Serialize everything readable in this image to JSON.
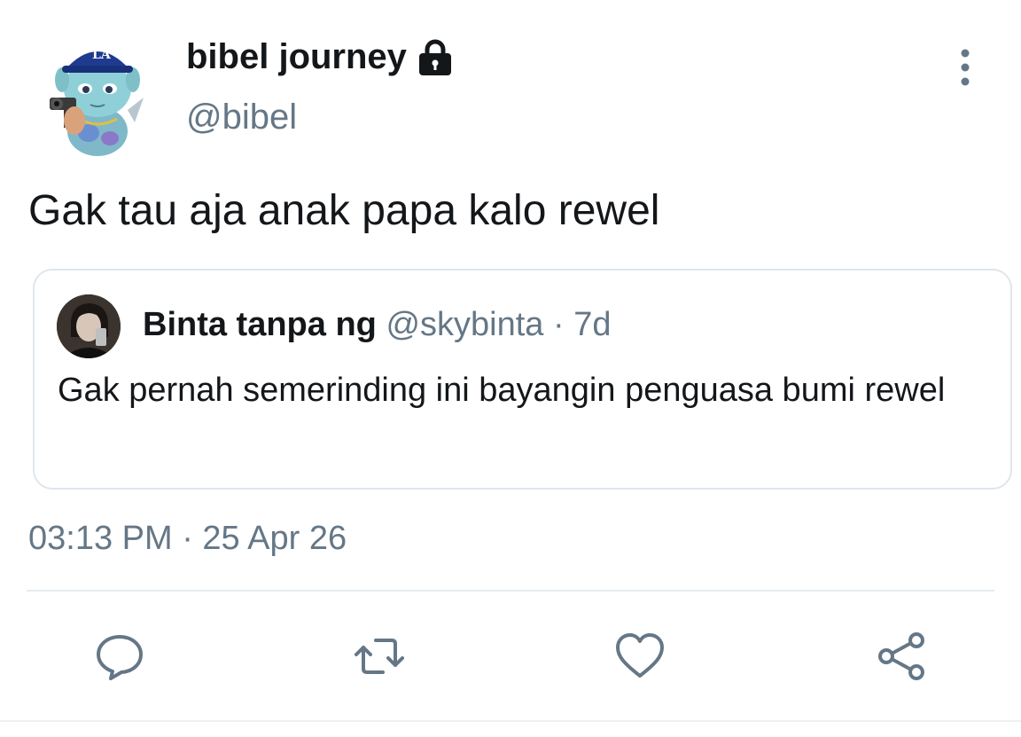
{
  "tweet": {
    "author": {
      "display_name": "bibel journey",
      "handle": "@bibel",
      "avatar_icon": "cartoon-alien-with-cap-avatar",
      "protected": true
    },
    "text": "Gak tau aja anak papa kalo rewel",
    "timestamp": "03:13 PM · 25 Apr 26",
    "quoted": {
      "display_name": "Binta tanpa ng",
      "handle": "@skybinta",
      "separator": "·",
      "time": "7d",
      "text": "Gak pernah semerinding ini bayangin penguasa bumi rewel"
    }
  },
  "icons": {
    "lock": "lock-icon",
    "more": "more-vertical-icon",
    "reply": "reply-icon",
    "retweet": "retweet-icon",
    "like": "heart-icon",
    "share": "share-icon"
  },
  "colors": {
    "text": "#14171a",
    "secondary": "#657786",
    "border": "#dfe6ec",
    "cap": "#1f3b8f"
  }
}
